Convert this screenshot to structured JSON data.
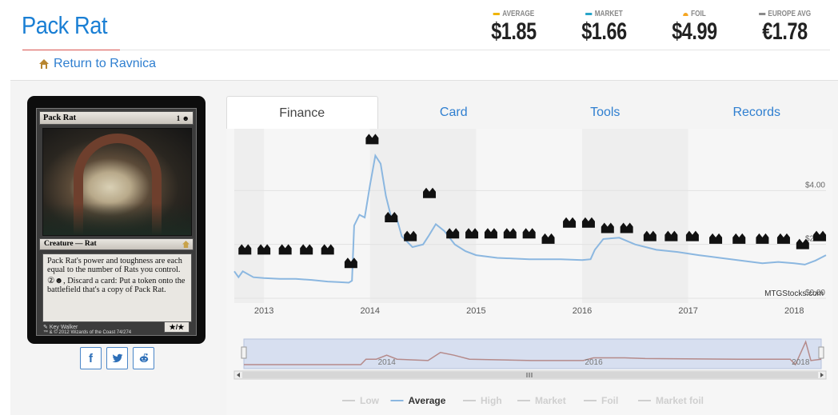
{
  "card": {
    "name": "Pack Rat",
    "set_name": "Return to Ravnica",
    "image": {
      "name": "Pack Rat",
      "mana_cost": "1",
      "type_line": "Creature — Rat",
      "rules_1": "Pack Rat's power and toughness are each equal to the number of Rats you control.",
      "rules_2": "②☻, Discard a card: Put a token onto the battlefield that's a copy of Pack Rat.",
      "artist": "Key Walker",
      "copyright": "™ & © 2012 Wizards of the Coast 74/274",
      "pt": "★/★"
    }
  },
  "prices": [
    {
      "label": "AVERAGE",
      "value": "$1.85",
      "color": "#f0b400"
    },
    {
      "label": "MARKET",
      "value": "$1.66",
      "color": "#28a4c9"
    },
    {
      "label": "FOIL",
      "value": "$4.99",
      "color": "#f5a623"
    },
    {
      "label": "EUROPE AVG",
      "value": "€1.78",
      "color": "#8a8a8a"
    }
  ],
  "share": [
    "f",
    "twitter-icon",
    "reddit-icon"
  ],
  "tabs": [
    {
      "label": "Finance",
      "active": true
    },
    {
      "label": "Card",
      "active": false
    },
    {
      "label": "Tools",
      "active": false
    },
    {
      "label": "Records",
      "active": false
    }
  ],
  "chart_data": {
    "type": "line",
    "title": "",
    "credit": "MTGStocks.com",
    "y_labels": [
      "$4.00",
      "$2.00",
      "$0.00"
    ],
    "ylim": [
      0,
      6
    ],
    "x_tick_labels": [
      "2013",
      "2014",
      "2015",
      "2016",
      "2017",
      "2018"
    ],
    "xlim": [
      2012.72,
      2018.3
    ],
    "series": [
      {
        "name": "Average",
        "color": "#8bb7e0",
        "points": [
          [
            2012.72,
            1.0
          ],
          [
            2012.76,
            0.78
          ],
          [
            2012.8,
            1.0
          ],
          [
            2012.9,
            0.78
          ],
          [
            2013.0,
            0.75
          ],
          [
            2013.15,
            0.72
          ],
          [
            2013.3,
            0.72
          ],
          [
            2013.45,
            0.68
          ],
          [
            2013.6,
            0.62
          ],
          [
            2013.7,
            0.6
          ],
          [
            2013.8,
            0.58
          ],
          [
            2013.83,
            0.65
          ],
          [
            2013.85,
            2.7
          ],
          [
            2013.9,
            3.1
          ],
          [
            2013.95,
            3.0
          ],
          [
            2014.0,
            4.2
          ],
          [
            2014.05,
            5.3
          ],
          [
            2014.1,
            5.0
          ],
          [
            2014.15,
            3.8
          ],
          [
            2014.2,
            3.0
          ],
          [
            2014.25,
            3.0
          ],
          [
            2014.3,
            2.3
          ],
          [
            2014.4,
            1.9
          ],
          [
            2014.5,
            2.0
          ],
          [
            2014.55,
            2.3
          ],
          [
            2014.62,
            2.75
          ],
          [
            2014.7,
            2.5
          ],
          [
            2014.8,
            2.0
          ],
          [
            2014.9,
            1.75
          ],
          [
            2015.0,
            1.6
          ],
          [
            2015.2,
            1.5
          ],
          [
            2015.5,
            1.45
          ],
          [
            2015.8,
            1.45
          ],
          [
            2016.0,
            1.42
          ],
          [
            2016.08,
            1.45
          ],
          [
            2016.12,
            1.8
          ],
          [
            2016.2,
            2.2
          ],
          [
            2016.35,
            2.25
          ],
          [
            2016.5,
            2.0
          ],
          [
            2016.7,
            1.8
          ],
          [
            2016.9,
            1.72
          ],
          [
            2017.1,
            1.6
          ],
          [
            2017.3,
            1.5
          ],
          [
            2017.5,
            1.4
          ],
          [
            2017.7,
            1.3
          ],
          [
            2017.85,
            1.35
          ],
          [
            2018.0,
            1.3
          ],
          [
            2018.1,
            1.25
          ],
          [
            2018.2,
            1.4
          ],
          [
            2018.3,
            1.6
          ]
        ]
      }
    ],
    "legend": [
      {
        "name": "Low",
        "color": "#cfcfcf",
        "active": false
      },
      {
        "name": "Average",
        "color": "#8bb7e0",
        "active": true
      },
      {
        "name": "High",
        "color": "#cfcfcf",
        "active": false
      },
      {
        "name": "Market",
        "color": "#cfcfcf",
        "active": false
      },
      {
        "name": "Foil",
        "color": "#cfcfcf",
        "active": false
      },
      {
        "name": "Market foil",
        "color": "#cfcfcf",
        "active": false
      }
    ],
    "navigator": {
      "labels": [
        "2014",
        "2016",
        "2018"
      ],
      "series": [
        [
          2012.72,
          0.3
        ],
        [
          2013.85,
          0.3
        ],
        [
          2013.9,
          0.7
        ],
        [
          2014.0,
          0.7
        ],
        [
          2014.1,
          1.0
        ],
        [
          2014.2,
          0.7
        ],
        [
          2014.5,
          0.6
        ],
        [
          2014.62,
          1.2
        ],
        [
          2014.75,
          1.0
        ],
        [
          2014.9,
          0.7
        ],
        [
          2015.5,
          0.6
        ],
        [
          2016.0,
          0.6
        ],
        [
          2016.1,
          0.8
        ],
        [
          2016.4,
          0.8
        ],
        [
          2016.6,
          0.75
        ],
        [
          2017.5,
          0.7
        ],
        [
          2018.0,
          0.7
        ],
        [
          2018.05,
          0.3
        ],
        [
          2018.15,
          2.0
        ],
        [
          2018.2,
          0.6
        ],
        [
          2018.3,
          0.7
        ]
      ]
    },
    "markers": [
      {
        "x": 2012.82,
        "y": 1.8,
        "icon": "crown-icon"
      },
      {
        "x": 2013.0,
        "y": 1.8,
        "icon": "mountains-icon"
      },
      {
        "x": 2013.2,
        "y": 1.8,
        "icon": "archway-icon"
      },
      {
        "x": 2013.4,
        "y": 1.8,
        "icon": "helmet-icon"
      },
      {
        "x": 2013.6,
        "y": 1.8,
        "icon": "m14-icon"
      },
      {
        "x": 2013.82,
        "y": 1.3,
        "icon": "trident-icon"
      },
      {
        "x": 2014.02,
        "y": 5.9,
        "icon": "theros-icon"
      },
      {
        "x": 2014.2,
        "y": 3.0,
        "icon": "born-icon"
      },
      {
        "x": 2014.38,
        "y": 2.3,
        "icon": "m15-icon"
      },
      {
        "x": 2014.56,
        "y": 3.9,
        "icon": "ktk-icon"
      },
      {
        "x": 2014.78,
        "y": 2.4,
        "icon": "frf-icon"
      },
      {
        "x": 2014.96,
        "y": 2.4,
        "icon": "dtk-icon"
      },
      {
        "x": 2015.14,
        "y": 2.4,
        "icon": "ori-icon"
      },
      {
        "x": 2015.32,
        "y": 2.4,
        "icon": "bfz-icon"
      },
      {
        "x": 2015.5,
        "y": 2.4,
        "icon": "ogw-icon"
      },
      {
        "x": 2015.68,
        "y": 2.2,
        "icon": "soi-icon"
      },
      {
        "x": 2015.88,
        "y": 2.8,
        "icon": "emn-icon"
      },
      {
        "x": 2016.06,
        "y": 2.8,
        "icon": "kld-icon"
      },
      {
        "x": 2016.24,
        "y": 2.6,
        "icon": "aer-icon"
      },
      {
        "x": 2016.42,
        "y": 2.6,
        "icon": "akh-icon"
      },
      {
        "x": 2016.64,
        "y": 2.3,
        "icon": "hou-icon"
      },
      {
        "x": 2016.84,
        "y": 2.3,
        "icon": "xln-icon"
      },
      {
        "x": 2017.04,
        "y": 2.3,
        "icon": "rix-icon"
      },
      {
        "x": 2017.26,
        "y": 2.2,
        "icon": "dom-icon"
      },
      {
        "x": 2017.48,
        "y": 2.2,
        "icon": "m19-icon"
      },
      {
        "x": 2017.7,
        "y": 2.2,
        "icon": "grn-icon"
      },
      {
        "x": 2017.9,
        "y": 2.2,
        "icon": "rna-icon"
      },
      {
        "x": 2018.08,
        "y": 2.0,
        "icon": "war-icon"
      },
      {
        "x": 2018.24,
        "y": 2.3,
        "icon": "mh1-icon"
      }
    ]
  }
}
